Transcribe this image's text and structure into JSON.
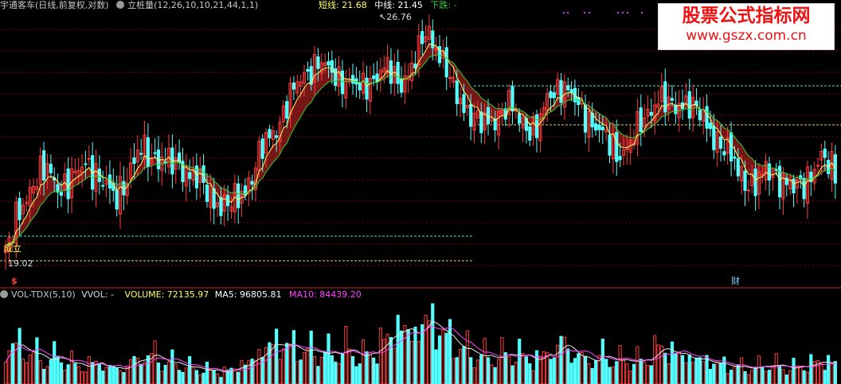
{
  "header": {
    "title": "宇通客车(日线,前复权,对数)",
    "indicator": "立桩量(12,26,10,10,21,44,1,1)",
    "short_line": "短线: 21.68",
    "mid_line": "中线: 21.45",
    "trend": "下跌: -"
  },
  "main_panel": {
    "high_marker": "26.76",
    "low_marker": "19.02",
    "buy_signal": "成立",
    "badge_s": "$",
    "badge_cai": "财"
  },
  "volume_panel": {
    "title": "VOL-TDX(5,10)",
    "vvol": "VVOL: -",
    "volume": "VOLUME: 72135.97",
    "ma5": "MA5: 96805.81",
    "ma10": "MA10: 84439.20"
  },
  "watermark": {
    "line1": "股票公式指标网",
    "line2": "www.gszx.com.cn"
  },
  "colors": {
    "up": "#ff3d3d",
    "down": "#54ffff",
    "short_line": "#ffff66",
    "mid_line": "#33cc33",
    "ribbon": "#8b1a1a",
    "ma5": "#e8e8e8",
    "ma10": "#ff44ff",
    "grid": "#8b0000"
  },
  "chart_data": {
    "type": "candlestick",
    "y_scale": "log",
    "close_series": [
      19.02,
      20.2,
      21.2,
      21.6,
      21.0,
      21.3,
      21.9,
      21.2,
      20.7,
      21.4,
      22.3,
      22.0,
      21.8,
      21.7,
      21.3,
      20.8,
      20.4,
      20.6,
      21.3,
      22.4,
      23.1,
      24.2,
      25.0,
      25.4,
      25.0,
      24.7,
      24.4,
      24.8,
      25.2,
      24.6,
      25.3,
      26.76,
      25.6,
      24.3,
      23.6,
      23.1,
      23.4,
      23.8,
      23.2,
      22.9,
      24.2,
      24.6,
      23.8,
      23.3,
      22.7,
      22.1,
      22.5,
      23.4,
      24.1,
      23.7,
      24.0,
      23.5,
      22.8,
      22.2,
      21.5,
      21.0,
      21.6,
      21.3,
      20.9,
      21.4,
      21.9,
      21.6
    ],
    "volume_series": [
      110,
      95,
      80,
      60,
      72,
      50,
      45,
      64,
      40,
      55,
      82,
      70,
      56,
      48,
      40,
      36,
      30,
      44,
      58,
      92,
      110,
      96,
      85,
      88,
      76,
      92,
      70,
      84,
      118,
      150,
      126,
      170,
      140,
      100,
      86,
      73,
      68,
      80,
      74,
      60,
      92,
      120,
      80,
      68,
      72,
      60,
      64,
      58,
      96,
      84,
      70,
      64,
      56,
      48,
      44,
      40,
      52,
      46,
      42,
      50,
      60,
      54
    ],
    "short_line_last": 21.68,
    "mid_line_last": 21.45,
    "volume_last": 72135.97,
    "ma5_last": 96805.81,
    "ma10_last": 84439.2,
    "annotated_high": 26.76,
    "annotated_low": 19.02
  }
}
